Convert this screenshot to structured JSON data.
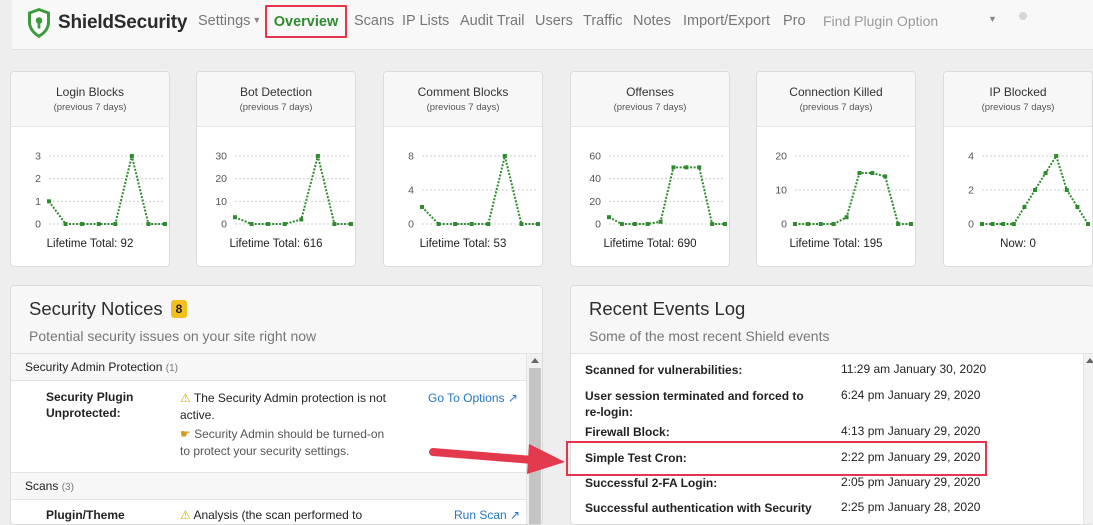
{
  "brand": {
    "name": "ShieldSecurity"
  },
  "nav": {
    "items": [
      "Settings",
      "Overview",
      "Scans",
      "IP Lists",
      "Audit Trail",
      "Users",
      "Traffic",
      "Notes",
      "Import/Export",
      "Pro"
    ],
    "search_placeholder": "Find Plugin Option"
  },
  "cards": [
    {
      "title": "Login Blocks",
      "subtitle": "(previous 7 days)",
      "footer": "Lifetime Total: 92",
      "chart_data": {
        "type": "line",
        "y_ticks": [
          "3",
          "2",
          "1",
          "0"
        ],
        "ylim": [
          0,
          3
        ],
        "values": [
          1,
          0,
          0,
          0,
          0,
          3,
          0,
          0
        ]
      }
    },
    {
      "title": "Bot Detection",
      "subtitle": "(previous 7 days)",
      "footer": "Lifetime Total: 616",
      "chart_data": {
        "type": "line",
        "y_ticks": [
          "30",
          "20",
          "10",
          "0"
        ],
        "ylim": [
          0,
          30
        ],
        "values": [
          3,
          0,
          0,
          0,
          2,
          30,
          0,
          0
        ]
      }
    },
    {
      "title": "Comment Blocks",
      "subtitle": "(previous 7 days)",
      "footer": "Lifetime Total: 53",
      "chart_data": {
        "type": "line",
        "y_ticks": [
          "8",
          "4",
          "0"
        ],
        "ylim": [
          0,
          8
        ],
        "values": [
          2,
          0,
          0,
          0,
          0,
          8,
          0,
          0
        ]
      }
    },
    {
      "title": "Offenses",
      "subtitle": "(previous 7 days)",
      "footer": "Lifetime Total: 690",
      "chart_data": {
        "type": "line",
        "y_ticks": [
          "60",
          "40",
          "20",
          "0"
        ],
        "ylim": [
          0,
          60
        ],
        "values": [
          6,
          0,
          0,
          0,
          2,
          50,
          50,
          50,
          0,
          0
        ]
      }
    },
    {
      "title": "Connection Killed",
      "subtitle": "(previous 7 days)",
      "footer": "Lifetime Total: 195",
      "chart_data": {
        "type": "line",
        "y_ticks": [
          "20",
          "10",
          "0"
        ],
        "ylim": [
          0,
          20
        ],
        "values": [
          0,
          0,
          0,
          0,
          2,
          15,
          15,
          14,
          0,
          0
        ]
      }
    },
    {
      "title": "IP Blocked",
      "subtitle": "(previous 7 days)",
      "footer": "Now: 0",
      "chart_data": {
        "type": "line",
        "y_ticks": [
          "4",
          "2",
          "0"
        ],
        "ylim": [
          0,
          4
        ],
        "values": [
          0,
          0,
          0,
          0,
          1,
          2,
          3,
          4,
          2,
          1,
          0
        ]
      }
    }
  ],
  "notices": {
    "title": "Security Notices",
    "badge": "8",
    "subtitle": "Potential security issues on your site right now",
    "groups": [
      {
        "name": "Security Admin Protection",
        "count": "(1)"
      },
      {
        "name": "Scans",
        "count": "(3)"
      }
    ],
    "items": [
      {
        "label_line1": "Security Plugin",
        "label_line2": "Unprotected:",
        "msg1_line1": "The Security Admin protection is not",
        "msg1_line2": "active.",
        "msg2_line1": "Security Admin should be turned-on",
        "msg2_line2": "to protect your security settings.",
        "action": "Go To Options ↗"
      },
      {
        "label_line1": "Plugin/Theme",
        "msg1_line1": "Analysis (the scan performed to",
        "action": "Run Scan ↗"
      }
    ]
  },
  "events": {
    "title": "Recent Events Log",
    "subtitle": "Some of the most recent Shield events",
    "rows": [
      {
        "label": "Scanned for vulnerabilities:",
        "time": "11:29 am January 30, 2020"
      },
      {
        "label": "User session terminated and forced to re-login:",
        "time": "6:24 pm January 29, 2020"
      },
      {
        "label": "Firewall Block:",
        "time": "4:13 pm January 29, 2020"
      },
      {
        "label": "Simple Test Cron:",
        "time": "2:22 pm January 29, 2020"
      },
      {
        "label": "Successful 2-FA Login:",
        "time": "2:05 pm January 29, 2020"
      },
      {
        "label": "Successful authentication with Security",
        "time": "2:25 pm January 28, 2020"
      }
    ]
  },
  "colors": {
    "chart_line": "#2e8b2e",
    "highlight": "#e5344b",
    "arrow": "#e23a4c",
    "badge": "#f4c01e",
    "link": "#2477c8"
  }
}
